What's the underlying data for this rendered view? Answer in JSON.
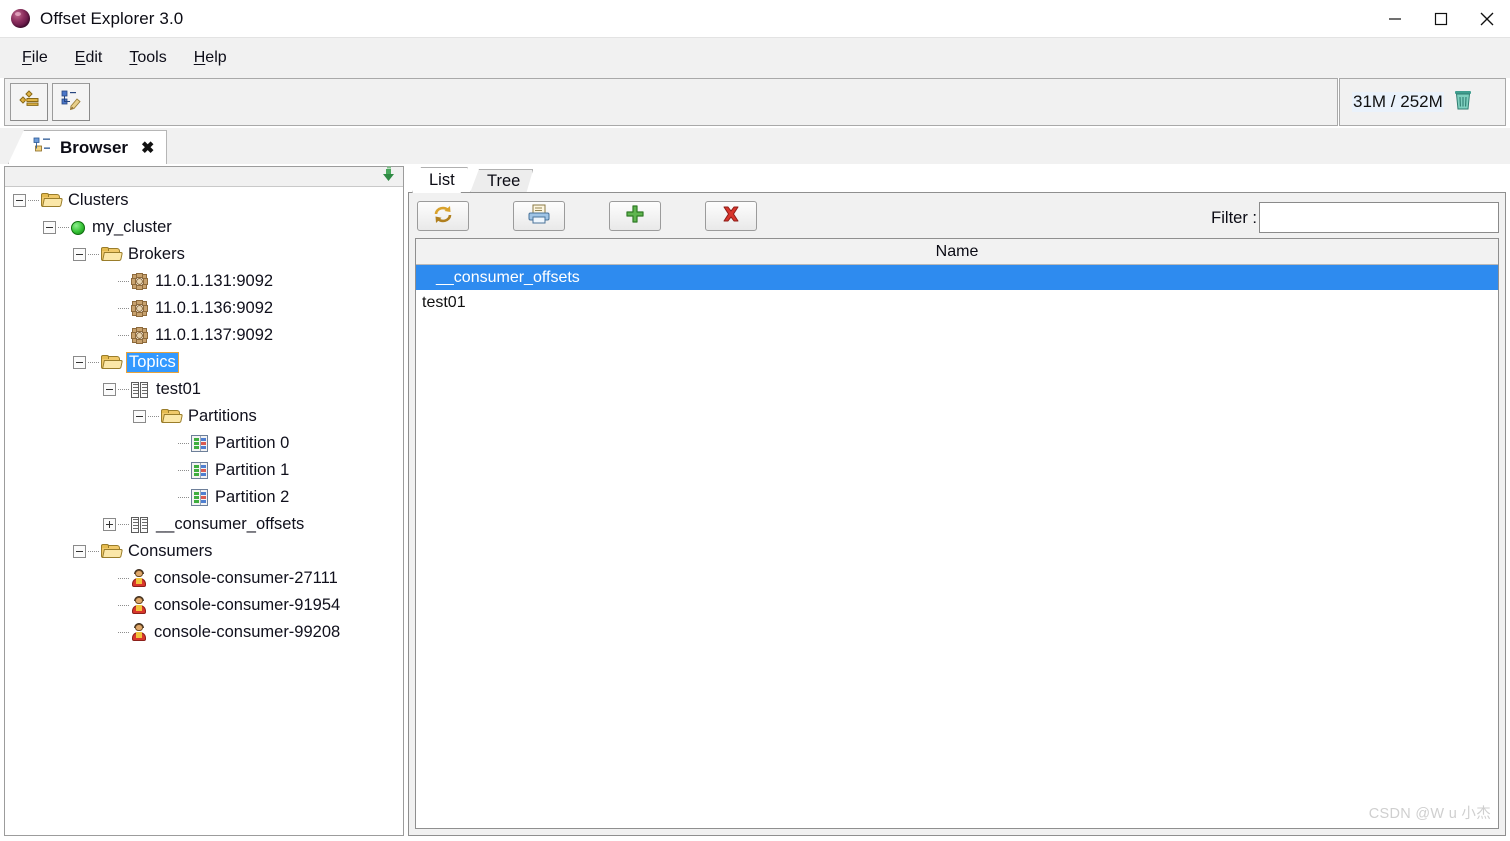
{
  "window": {
    "title": "Offset Explorer  3.0",
    "app_icon": "sphere-icon",
    "controls": {
      "minimize": "minimize-icon",
      "maximize": "maximize-icon",
      "close": "close-icon"
    }
  },
  "menubar": {
    "items": [
      {
        "label": "File",
        "mnemonic": "F"
      },
      {
        "label": "Edit",
        "mnemonic": "E"
      },
      {
        "label": "Tools",
        "mnemonic": "T"
      },
      {
        "label": "Help",
        "mnemonic": "H"
      }
    ]
  },
  "toolbar": {
    "buttons": [
      {
        "name": "add-cluster-button",
        "icon": "connector-icon"
      },
      {
        "name": "edit-cluster-button",
        "icon": "tree-pencil-icon"
      }
    ],
    "memory": {
      "text": "31M / 252M",
      "icon": "trash-icon"
    }
  },
  "tabstrip": {
    "tabs": [
      {
        "label": "Browser",
        "icon": "tree-icon",
        "close": "✖",
        "active": true
      }
    ]
  },
  "tree_panel": {
    "collapse_icon": "collapse-all-icon",
    "nodes": [
      {
        "label": "Clusters",
        "depth": 0,
        "expander": "minus",
        "icon": "folder-icon",
        "selected": false
      },
      {
        "label": "my_cluster",
        "depth": 1,
        "expander": "minus",
        "icon": "green-dot-icon",
        "selected": false
      },
      {
        "label": "Brokers",
        "depth": 2,
        "expander": "minus",
        "icon": "folder-icon",
        "selected": false
      },
      {
        "label": "11.0.1.131:9092",
        "depth": 3,
        "expander": "none",
        "icon": "broker-icon",
        "selected": false
      },
      {
        "label": "11.0.1.136:9092",
        "depth": 3,
        "expander": "none",
        "icon": "broker-icon",
        "selected": false
      },
      {
        "label": "11.0.1.137:9092",
        "depth": 3,
        "expander": "none",
        "icon": "broker-icon",
        "selected": false
      },
      {
        "label": "Topics",
        "depth": 2,
        "expander": "minus",
        "icon": "folder-icon",
        "selected": true
      },
      {
        "label": "test01",
        "depth": 3,
        "expander": "minus",
        "icon": "topic-icon",
        "selected": false
      },
      {
        "label": "Partitions",
        "depth": 4,
        "expander": "minus",
        "icon": "folder-icon",
        "selected": false
      },
      {
        "label": "Partition 0",
        "depth": 5,
        "expander": "none",
        "icon": "partition-icon",
        "selected": false
      },
      {
        "label": "Partition 1",
        "depth": 5,
        "expander": "none",
        "icon": "partition-icon",
        "selected": false
      },
      {
        "label": "Partition 2",
        "depth": 5,
        "expander": "none",
        "icon": "partition-icon",
        "selected": false
      },
      {
        "label": "__consumer_offsets",
        "depth": 3,
        "expander": "plus",
        "icon": "topic-icon",
        "selected": false
      },
      {
        "label": "Consumers",
        "depth": 2,
        "expander": "minus",
        "icon": "folder-icon",
        "selected": false
      },
      {
        "label": "console-consumer-27111",
        "depth": 3,
        "expander": "none",
        "icon": "consumer-icon",
        "selected": false
      },
      {
        "label": "console-consumer-91954",
        "depth": 3,
        "expander": "none",
        "icon": "consumer-icon",
        "selected": false
      },
      {
        "label": "console-consumer-99208",
        "depth": 3,
        "expander": "none",
        "icon": "consumer-icon",
        "selected": false
      }
    ]
  },
  "content_panel": {
    "tabs": [
      {
        "label": "List",
        "active": true
      },
      {
        "label": "Tree",
        "active": false
      }
    ],
    "toolbar_buttons": [
      {
        "name": "refresh-button",
        "icon": "refresh-icon"
      },
      {
        "name": "print-button",
        "icon": "printer-icon"
      },
      {
        "name": "add-button",
        "icon": "plus-icon"
      },
      {
        "name": "delete-button",
        "icon": "delete-icon"
      }
    ],
    "filter": {
      "label": "Filter :",
      "value": "",
      "placeholder": ""
    },
    "table": {
      "columns": [
        "Name"
      ],
      "rows": [
        {
          "Name": "__consumer_offsets",
          "selected": true
        },
        {
          "Name": "test01",
          "selected": false
        }
      ]
    }
  },
  "watermark": {
    "text": "CSDN @W u 小杰"
  },
  "colors": {
    "selection_blue": "#2e8bef",
    "tree_selection_blue": "#3399ff",
    "tree_selection_border": "#e8a33d",
    "chrome_gray": "#f1f1f1"
  }
}
